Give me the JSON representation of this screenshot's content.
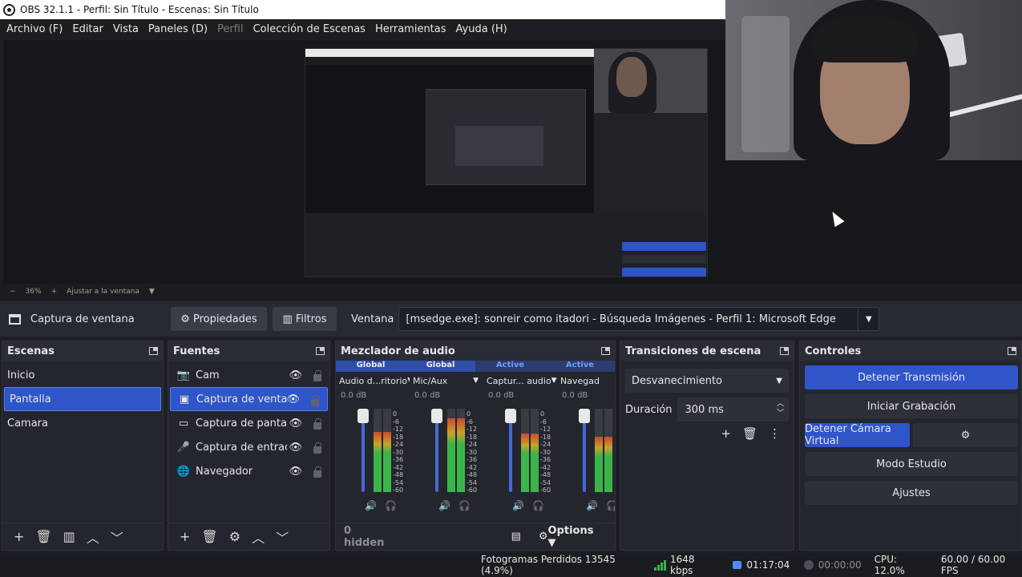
{
  "window": {
    "title": "OBS 32.1.1 - Perfil: Sin Título - Escenas: Sin Título"
  },
  "menu": [
    {
      "label": "Archivo (F)",
      "disabled": false
    },
    {
      "label": "Editar",
      "disabled": false
    },
    {
      "label": "Vista",
      "disabled": false
    },
    {
      "label": "Paneles (D)",
      "disabled": false
    },
    {
      "label": "Perfil",
      "disabled": true
    },
    {
      "label": "Colección de Escenas",
      "disabled": false
    },
    {
      "label": "Herramientas",
      "disabled": false
    },
    {
      "label": "Ayuda (H)",
      "disabled": false
    }
  ],
  "zoom": {
    "minus": "−",
    "value": "36%",
    "plus": "+",
    "fit_label": "Ajustar a la ventana"
  },
  "source_toolbar": {
    "source_name": "Captura de ventana",
    "properties_label": "Propiedades",
    "filters_label": "Filtros",
    "window_label": "Ventana",
    "window_value": "[msedge.exe]: sonreir como itadori - Búsqueda Imágenes - Perfil 1: Microsoft Edge"
  },
  "scenes": {
    "title": "Escenas",
    "items": [
      "Inicio",
      "Pantalla",
      "Camara"
    ],
    "selected_index": 1
  },
  "sources": {
    "title": "Fuentes",
    "items": [
      {
        "label": "Cam",
        "icon": "camera-icon"
      },
      {
        "label": "Captura de ventan",
        "icon": "window-icon"
      },
      {
        "label": "Captura de pantall",
        "icon": "monitor-icon"
      },
      {
        "label": "Captura de entrad",
        "icon": "microphone-icon"
      },
      {
        "label": "Navegador",
        "icon": "globe-icon"
      }
    ],
    "selected_index": 1
  },
  "mixer": {
    "title": "Mezclador de audio",
    "headers": [
      "Global",
      "Global",
      "Active",
      "Active"
    ],
    "channels": [
      {
        "name": "Audio d...ritorio",
        "db": "0.0 dB",
        "level": 0.72
      },
      {
        "name": "Mic/Aux",
        "db": "0.0 dB",
        "level": 0.88
      },
      {
        "name": "Captur... audio",
        "db": "0.0 dB",
        "level": 0.7
      },
      {
        "name": "Navegad",
        "db": "0.0 dB",
        "level": 0.66
      }
    ],
    "scale": [
      "0",
      "-6",
      "-12",
      "-18",
      "-24",
      "-30",
      "-36",
      "-42",
      "-48",
      "-54",
      "-60"
    ],
    "hidden_label": "0 hidden",
    "options_label": "Options"
  },
  "transitions": {
    "title": "Transiciones de escena",
    "selected": "Desvanecimiento",
    "duration_label": "Duración",
    "duration_value": "300 ms"
  },
  "controls": {
    "title": "Controles",
    "stop_stream": "Detener Transmisión",
    "start_record": "Iniciar Grabación",
    "stop_virtualcam": "Detener Cámara Virtual",
    "studio_mode": "Modo Estudio",
    "settings": "Ajustes"
  },
  "status": {
    "dropped_frames": "Fotogramas Perdidos 13545 (4.9%)",
    "bitrate": "1648 kbps",
    "stream_time": "01:17:04",
    "record_time": "00:00:00",
    "cpu": "CPU: 12.0%",
    "fps": "60.00 / 60.00 FPS"
  },
  "colors": {
    "accent": "#2f55c9",
    "meter_green": "#3bb54a",
    "meter_yellow": "#c9a22b",
    "meter_red": "#c94a2b"
  }
}
